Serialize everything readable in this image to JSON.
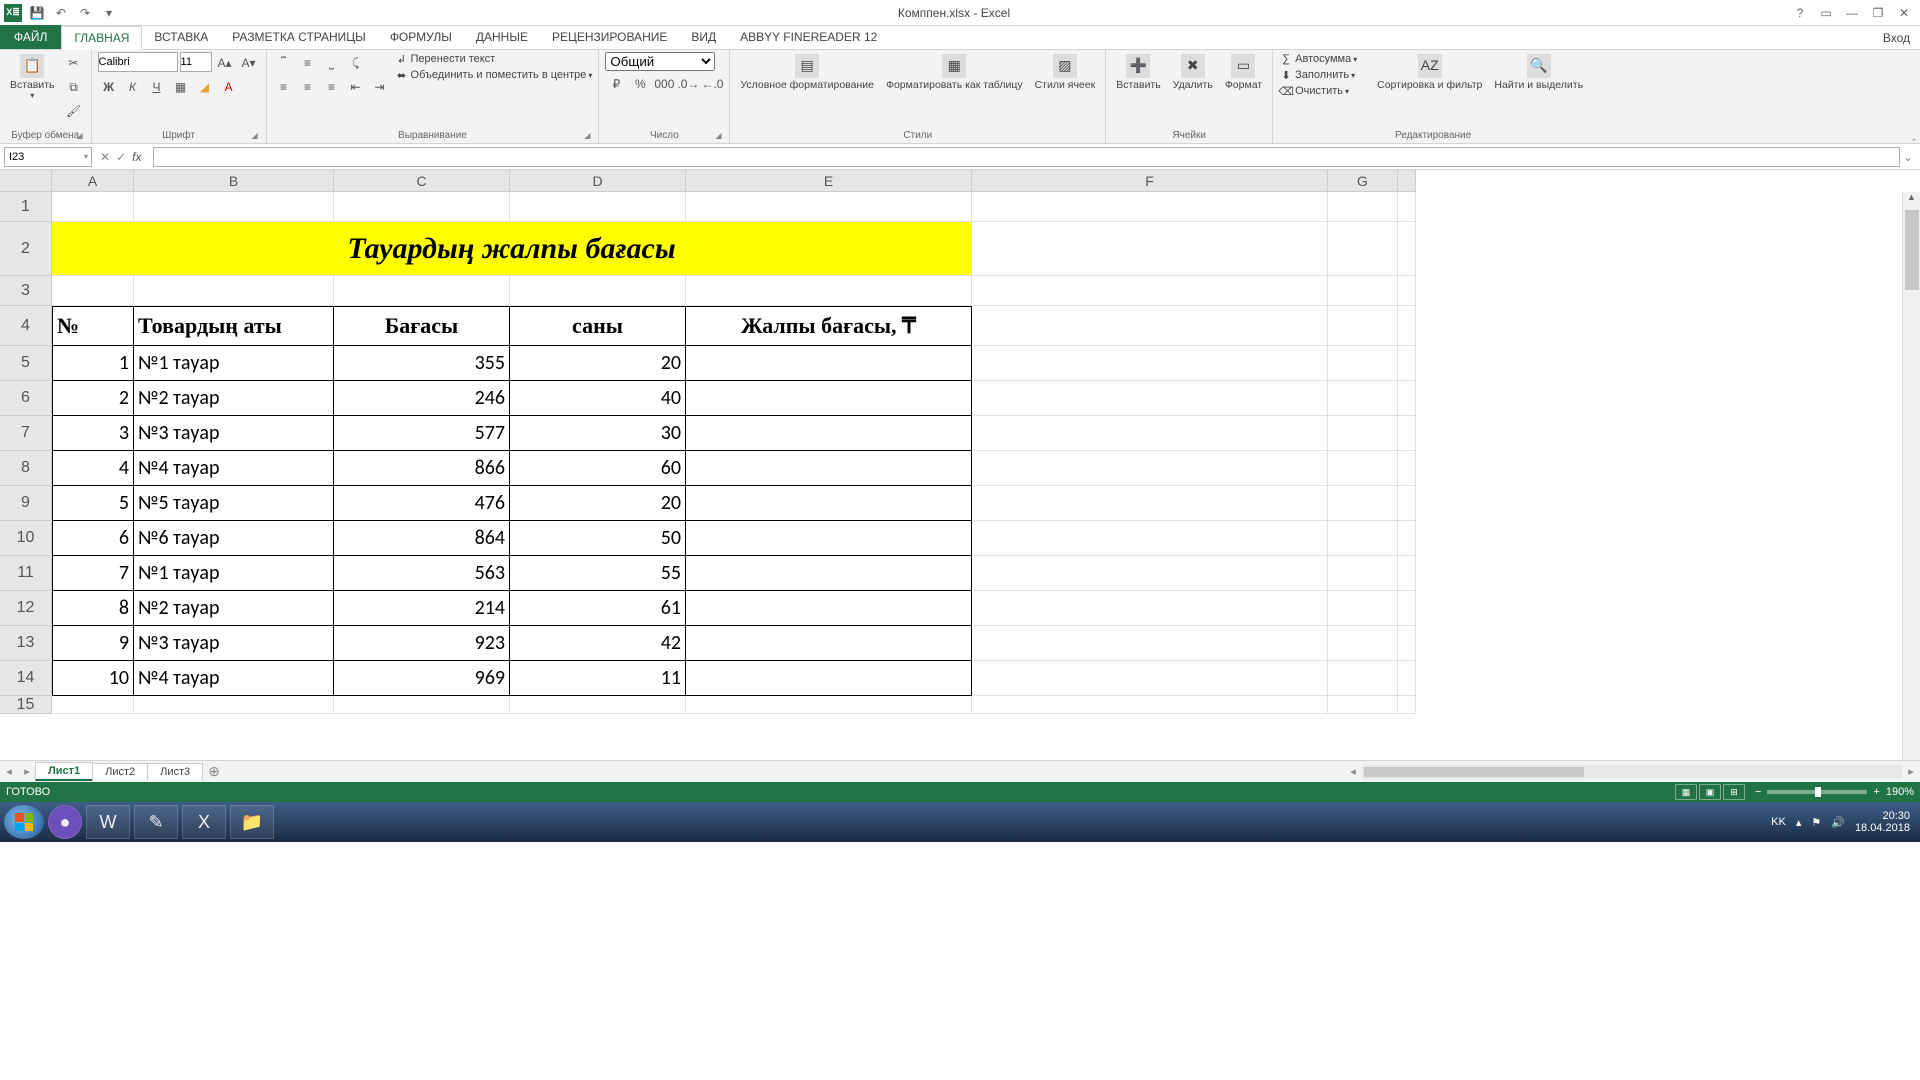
{
  "app": {
    "title": "Комппен.xlsx - Excel",
    "help_icon": "?",
    "ribbon_display_icon": "▭",
    "minimize": "—",
    "restore": "❐",
    "close": "✕"
  },
  "qat": {
    "save": "💾",
    "undo": "↶",
    "redo": "↷",
    "customize": "▾"
  },
  "tabs": {
    "file": "ФАЙЛ",
    "items": [
      "ГЛАВНАЯ",
      "ВСТАВКА",
      "РАЗМЕТКА СТРАНИЦЫ",
      "ФОРМУЛЫ",
      "ДАННЫЕ",
      "РЕЦЕНЗИРОВАНИЕ",
      "ВИД",
      "ABBYY FineReader 12"
    ],
    "active": 0,
    "signin": "Вход"
  },
  "ribbon": {
    "clipboard": {
      "label": "Буфер обмена",
      "paste": "Вставить"
    },
    "font": {
      "label": "Шрифт",
      "name": "Calibri",
      "size": "11",
      "bold": "Ж",
      "italic": "К",
      "underline": "Ч"
    },
    "alignment": {
      "label": "Выравнивание",
      "wrap": "Перенести текст",
      "merge": "Объединить и поместить в центре"
    },
    "number": {
      "label": "Число",
      "format": "Общий",
      "percent": "%",
      "comma": "000"
    },
    "styles": {
      "label": "Стили",
      "conditional": "Условное форматирование",
      "as_table": "Форматировать как таблицу",
      "cell_styles": "Стили ячеек"
    },
    "cells": {
      "label": "Ячейки",
      "insert": "Вставить",
      "delete": "Удалить",
      "format": "Формат"
    },
    "editing": {
      "label": "Редактирование",
      "autosum": "Автосумма",
      "fill": "Заполнить",
      "clear": "Очистить",
      "sort": "Сортировка и фильтр",
      "find": "Найти и выделить"
    }
  },
  "namebox": "I23",
  "columns": [
    "A",
    "B",
    "C",
    "D",
    "E",
    "F",
    "G"
  ],
  "row_heights": {
    "normal": 36,
    "title": 54
  },
  "sheet": {
    "title": "Тауардың жалпы бағасы",
    "headers": {
      "num": "№",
      "name": "Товардың аты",
      "price": "Бағасы",
      "qty": "саны",
      "total": "Жалпы бағасы, ₸"
    },
    "rows": [
      {
        "n": 1,
        "name": "№1 тауар",
        "price": 355,
        "qty": 20
      },
      {
        "n": 2,
        "name": "№2 тауар",
        "price": 246,
        "qty": 40
      },
      {
        "n": 3,
        "name": "№3 тауар",
        "price": 577,
        "qty": 30
      },
      {
        "n": 4,
        "name": "№4 тауар",
        "price": 866,
        "qty": 60
      },
      {
        "n": 5,
        "name": "№5 тауар",
        "price": 476,
        "qty": 20
      },
      {
        "n": 6,
        "name": "№6 тауар",
        "price": 864,
        "qty": 50
      },
      {
        "n": 7,
        "name": "№1 тауар",
        "price": 563,
        "qty": 55
      },
      {
        "n": 8,
        "name": "№2 тауар",
        "price": 214,
        "qty": 61
      },
      {
        "n": 9,
        "name": "№3 тауар",
        "price": 923,
        "qty": 42
      },
      {
        "n": 10,
        "name": "№4 тауар",
        "price": 969,
        "qty": 11
      }
    ]
  },
  "sheet_tabs": {
    "items": [
      "Лист1",
      "Лист2",
      "Лист3"
    ],
    "active": 0,
    "add": "⊕"
  },
  "status": {
    "ready": "ГОТОВО",
    "zoom": "190%"
  },
  "taskbar": {
    "lang": "KK",
    "time": "20:30",
    "date": "18.04.2018"
  }
}
